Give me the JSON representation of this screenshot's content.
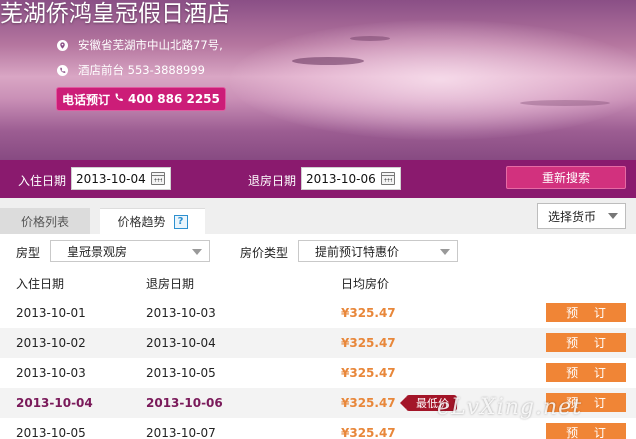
{
  "header": {
    "hotel_name": "芜湖侨鸿皇冠假日酒店",
    "address": "安徽省芜湖市中山北路77号,",
    "front_desk": "酒店前台 553-3888999",
    "phone_booking_label": "电话预订",
    "phone_booking_number": "400 886 2255"
  },
  "search": {
    "checkin_label": "入住日期",
    "checkin_value": "2013-10-04",
    "checkout_label": "退房日期",
    "checkout_value": "2013-10-06",
    "research_button": "重新搜索"
  },
  "tabs": [
    {
      "label": "价格列表",
      "active": false
    },
    {
      "label": "价格趋势",
      "active": true
    }
  ],
  "help_icon_text": "?",
  "currency_select": "选择货币",
  "filters": {
    "room_type_label": "房型",
    "room_type_value": "皇冠景观房",
    "rate_type_label": "房价类型",
    "rate_type_value": "提前预订特惠价"
  },
  "table": {
    "headers": [
      "入住日期",
      "退房日期",
      "日均房价"
    ],
    "book_label": "预订",
    "lowest_price_tag": "最低价",
    "rows": [
      {
        "checkin": "2013-10-01",
        "checkout": "2013-10-03",
        "price": "¥325.47",
        "book": "预 订"
      },
      {
        "checkin": "2013-10-02",
        "checkout": "2013-10-04",
        "price": "¥325.47",
        "book": "预 订"
      },
      {
        "checkin": "2013-10-03",
        "checkout": "2013-10-05",
        "price": "¥325.47",
        "book": "预 订"
      },
      {
        "checkin": "2013-10-04",
        "checkout": "2013-10-06",
        "price": "¥325.47",
        "book": "预 订",
        "highlight": true
      },
      {
        "checkin": "2013-10-05",
        "checkout": "2013-10-07",
        "price": "¥325.47",
        "book": "预 订"
      }
    ]
  },
  "watermark": "eLvXing.net",
  "colors": {
    "search_bar": "#8a1a6e",
    "phone_button": "#cc1d78",
    "research_button": "#d2317e",
    "book_button": "#f08536",
    "price": "#e8873a",
    "lowest_tag": "#a31528"
  }
}
